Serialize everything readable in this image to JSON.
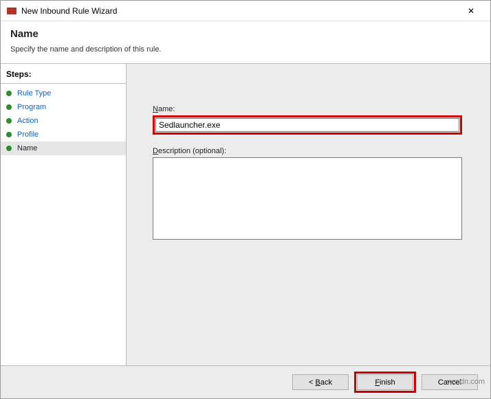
{
  "window": {
    "title": "New Inbound Rule Wizard",
    "close": "✕"
  },
  "header": {
    "title": "Name",
    "subtitle": "Specify the name and description of this rule."
  },
  "sidebar": {
    "heading": "Steps:",
    "items": [
      {
        "label": "Rule Type"
      },
      {
        "label": "Program"
      },
      {
        "label": "Action"
      },
      {
        "label": "Profile"
      },
      {
        "label": "Name"
      }
    ]
  },
  "form": {
    "name_label_pre": "N",
    "name_label_rest": "ame:",
    "name_value": "Sedlauncher.exe",
    "desc_label_pre": "D",
    "desc_label_rest": "escription (optional):",
    "desc_value": ""
  },
  "buttons": {
    "back_pre": "< ",
    "back_u": "B",
    "back_rest": "ack",
    "finish_u": "F",
    "finish_rest": "inish",
    "cancel": "Cancel"
  },
  "watermark": "wsxdn.com"
}
